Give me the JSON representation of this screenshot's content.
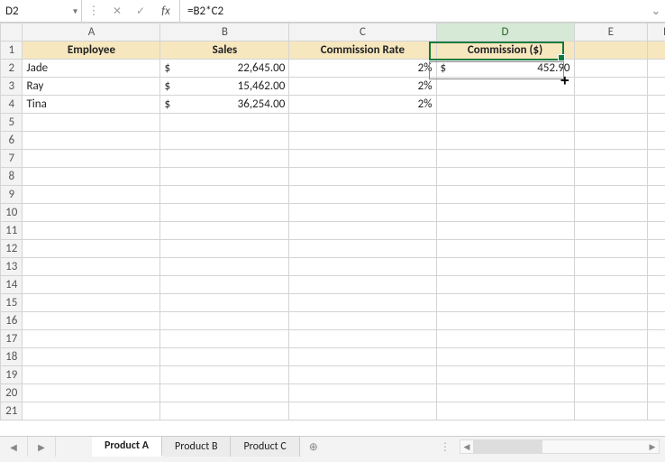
{
  "name_box": "D2",
  "formula": "=B2*C2",
  "columns": [
    "A",
    "B",
    "C",
    "D",
    "E",
    "F"
  ],
  "active_col_index": 3,
  "header_row": {
    "A": "Employee",
    "B": "Sales",
    "C": "Commission Rate",
    "D": "Commission ($)"
  },
  "data_rows": [
    {
      "employee": "Jade",
      "sales_sym": "$",
      "sales_val": "22,645.00",
      "rate": "2%",
      "comm_sym": "$",
      "comm_val": "452.90"
    },
    {
      "employee": "Ray",
      "sales_sym": "$",
      "sales_val": "15,462.00",
      "rate": "2%",
      "comm_sym": "",
      "comm_val": ""
    },
    {
      "employee": "Tina",
      "sales_sym": "$",
      "sales_val": "36,254.00",
      "rate": "2%",
      "comm_sym": "",
      "comm_val": ""
    }
  ],
  "row_count": 21,
  "sheets": [
    {
      "name": "Product A",
      "active": true
    },
    {
      "name": "Product B",
      "active": false
    },
    {
      "name": "Product C",
      "active": false
    }
  ],
  "icons": {
    "dropdown": "▾",
    "cancel": "✕",
    "accept": "✓",
    "fx": "fx",
    "expand": "⌄",
    "tab_prev": "◀",
    "tab_next": "▶",
    "add": "⊕",
    "menu_dots": "⋮",
    "scroll_left": "◀",
    "scroll_right": "▶",
    "drag_cursor": "+"
  }
}
